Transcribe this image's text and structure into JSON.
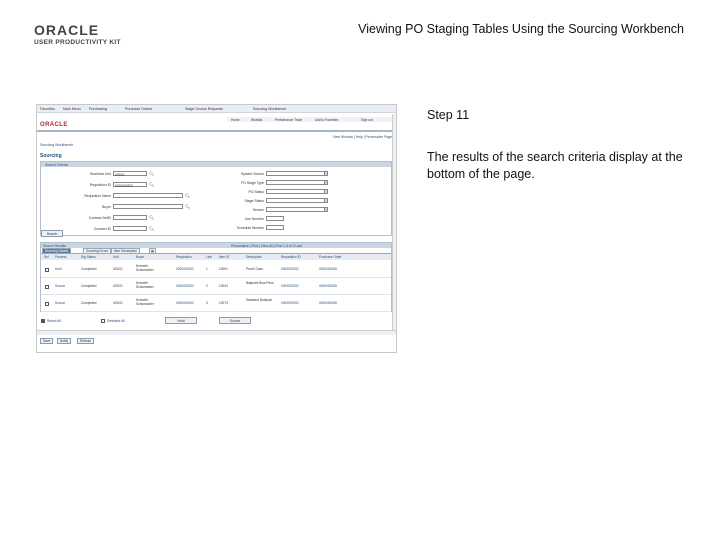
{
  "header": {
    "brand": "ORACLE",
    "brand_sub": "USER PRODUCTIVITY KIT",
    "doc_title": "Viewing PO Staging Tables Using the Sourcing Workbench"
  },
  "step": {
    "title": "Step 11",
    "description": "The results of the search criteria display at the bottom of the page."
  },
  "screenshot": {
    "nav_items": [
      "Favorites",
      "Main Menu",
      "Purchasing",
      "Purchase Orders",
      "Stage Source Requests",
      "Sourcing Workbench"
    ],
    "top_links": [
      "Home",
      "Worklist",
      "Performance Trace",
      "Add to Favorites",
      "Sign out"
    ],
    "mini_logo": "ORACLE",
    "subbar_right": "New Window | Help | Personalize Page",
    "breadcrumb": "Sourcing Workbench",
    "page_heading": "Sourcing",
    "criteria_header": "Search Criteria",
    "left_fields": [
      {
        "label": "Business Unit",
        "value": "US001"
      },
      {
        "label": "Requisition ID",
        "value": "0000000252"
      },
      {
        "label": "Requisition Name",
        "value": ""
      },
      {
        "label": "Buyer",
        "value": ""
      },
      {
        "label": "Contract SetID",
        "value": ""
      },
      {
        "label": "Contract ID",
        "value": ""
      }
    ],
    "right_fields": [
      {
        "label": "System Source",
        "value": ""
      },
      {
        "label": "PO Stage Type",
        "value": ""
      },
      {
        "label": "PO Status",
        "value": ""
      },
      {
        "label": "Stage Status",
        "value": ""
      },
      {
        "label": "Service",
        "value": ""
      },
      {
        "label": "Line Number",
        "value": ""
      },
      {
        "label": "Schedule Number",
        "value": ""
      }
    ],
    "search_button": "Search",
    "results_header": "Search Results",
    "results_nav": "Personalize | Find | View All | First 1-3 of 3 Last",
    "tabs": [
      "Sourcing Details",
      "Sourcing Errors",
      "Item Description"
    ],
    "columns": [
      "Sel",
      "Process",
      "Stg Status",
      "Unit",
      "Buyer",
      "Requisition",
      "Line",
      "Item ID",
      "Description",
      "Requisition ID",
      "Purchase Order"
    ],
    "rows": [
      {
        "process": "Hold",
        "status": "Completed",
        "unit": "US001",
        "buyer": "Kenneth Schumacher",
        "req": "0000000252",
        "line": "1",
        "item": "10001",
        "desc": "Pencil Case",
        "req_id": "0000000252",
        "po": "0000000268"
      },
      {
        "process": "Source",
        "status": "Completed",
        "unit": "US001",
        "buyer": "Kenneth Schumacher",
        "req": "0000000252",
        "line": "2",
        "item": "10024",
        "desc": "Ballpoint Blue Pens",
        "req_id": "0000000252",
        "po": "0000000268"
      },
      {
        "process": "Source",
        "status": "Completed",
        "unit": "US001",
        "buyer": "Kenneth Schumacher",
        "req": "0000000252",
        "line": "3",
        "item": "10073",
        "desc": "Standard Notepad",
        "req_id": "0000000252",
        "po": "0000000268"
      }
    ],
    "select_all": "Select All",
    "deselect_all": "Deselect All",
    "hold_button": "Hold",
    "source_button": "Source",
    "footer_buttons": [
      "Save",
      "Notify",
      "Refresh"
    ]
  }
}
